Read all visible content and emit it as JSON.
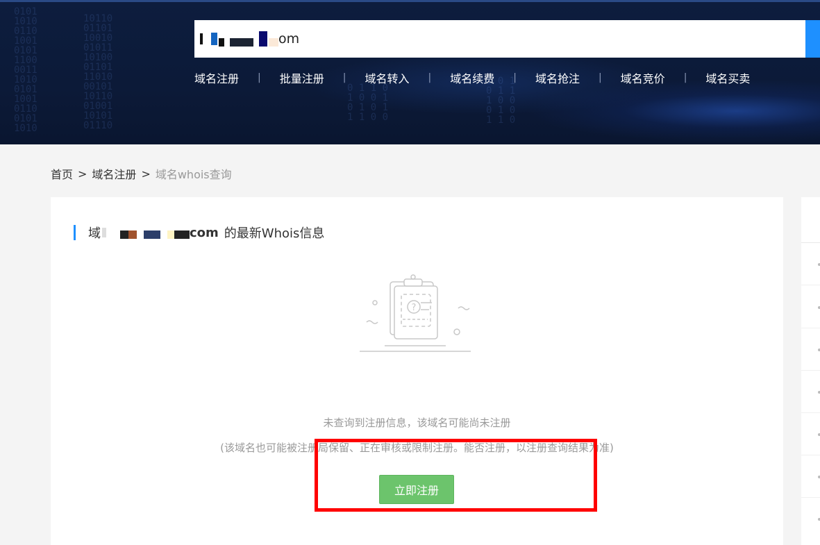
{
  "search": {
    "value_suffix": "om"
  },
  "nav": {
    "items": [
      "域名注册",
      "批量注册",
      "域名转入",
      "域名续费",
      "域名抢注",
      "域名竞价",
      "域名买卖"
    ],
    "separator": "|"
  },
  "breadcrumb": {
    "home": "首页",
    "separator": ">",
    "level1": "域名注册",
    "current": "域名whois查询"
  },
  "card": {
    "title_prefix": "域",
    "title_domain_suffix": "com",
    "title_suffix": "的最新Whois信息",
    "message_primary": "未查询到注册信息，该域名可能尚未注册",
    "message_secondary": "(该域名也可能被注册局保留、正在审核或限制注册。能否注册，以注册查询结果为准)",
    "register_button": "立即注册"
  },
  "colors": {
    "accent": "#1e90ff",
    "button_green": "#6cc46c",
    "highlight_red": "#ff0000",
    "banner_dark": "#0d1d3e"
  },
  "icons": [
    "clipboard-question-icon"
  ]
}
